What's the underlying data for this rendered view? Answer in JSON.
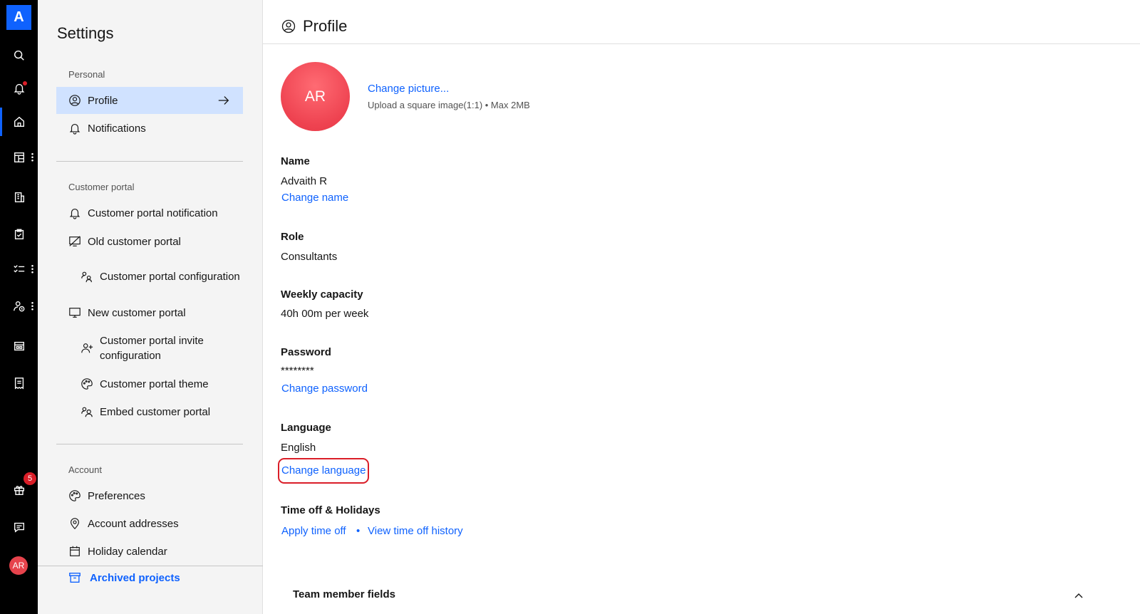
{
  "rail": {
    "logo": "A",
    "notification_badge": "5",
    "avatar": "AR"
  },
  "settings": {
    "title": "Settings",
    "sections": {
      "personal": "Personal",
      "customer_portal": "Customer portal",
      "account": "Account"
    },
    "items": {
      "profile": "Profile",
      "notifications": "Notifications",
      "cp_notification": "Customer portal notification",
      "old_cp": "Old customer portal",
      "cp_config": "Customer portal configuration",
      "new_cp": "New customer portal",
      "cp_invite": "Customer portal invite configuration",
      "cp_theme": "Customer portal theme",
      "embed_cp": "Embed customer portal",
      "preferences": "Preferences",
      "addresses": "Account addresses",
      "holiday": "Holiday calendar"
    },
    "archived": "Archived projects"
  },
  "profile": {
    "title": "Profile",
    "avatar_initials": "AR",
    "change_picture": "Change picture...",
    "upload_hint": "Upload a square image(1:1) • Max 2MB",
    "name_label": "Name",
    "name_value": "Advaith R",
    "change_name": "Change name",
    "role_label": "Role",
    "role_value": "Consultants",
    "capacity_label": "Weekly capacity",
    "capacity_value": "40h 00m per week",
    "password_label": "Password",
    "password_value": "********",
    "change_password": "Change password",
    "language_label": "Language",
    "language_value": "English",
    "change_language": "Change language",
    "timeoff_label": "Time off & Holidays",
    "apply_timeoff": "Apply time off",
    "separator": "•",
    "view_timeoff": "View time off history",
    "team_member_fields": "Team member fields"
  },
  "colors": {
    "accent": "#0f62fe",
    "selected_bg": "#d0e2ff",
    "highlight": "#da1e28",
    "avatar": "#ee4250"
  }
}
